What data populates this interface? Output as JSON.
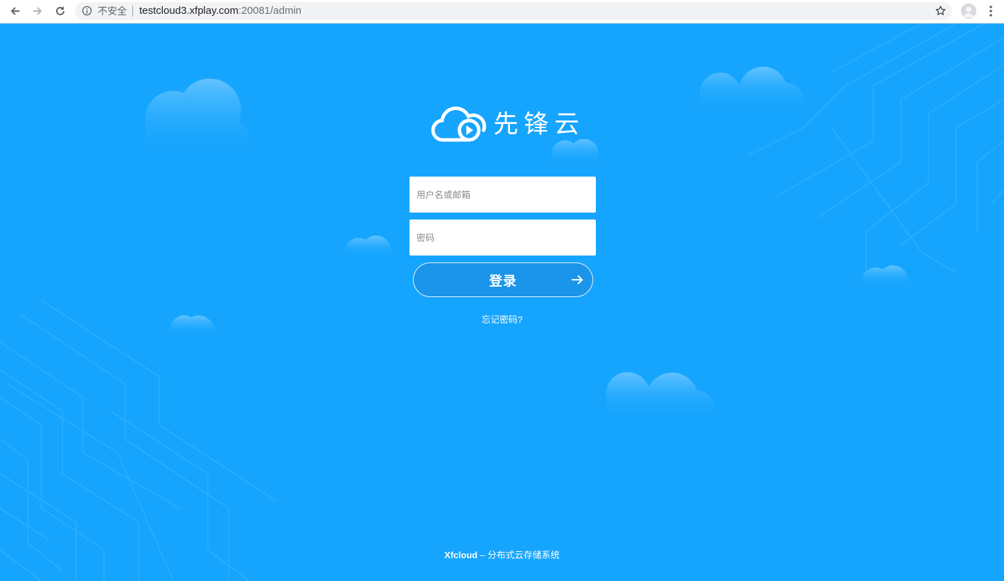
{
  "browser": {
    "insecure_label": "不安全",
    "url_host": "testcloud3.xfplay.com",
    "url_path": ":20081/admin",
    "icons": [
      "back-icon",
      "forward-icon",
      "reload-icon",
      "info-icon",
      "star-icon",
      "profile-icon",
      "menu-icon"
    ]
  },
  "logo": {
    "text": "先锋云",
    "icon": "cloud-play-icon"
  },
  "form": {
    "username_placeholder": "用户名或邮箱",
    "password_placeholder": "密码",
    "login_label": "登录",
    "login_icon": "arrow-right-icon",
    "forgot_label": "忘记密码?"
  },
  "footer": {
    "brand": "Xfcloud",
    "separator": " – ",
    "tagline": "分布式云存储系统"
  },
  "colors": {
    "background": "#16a5fe",
    "button": "#1b95ea",
    "text": "#ffffff"
  }
}
